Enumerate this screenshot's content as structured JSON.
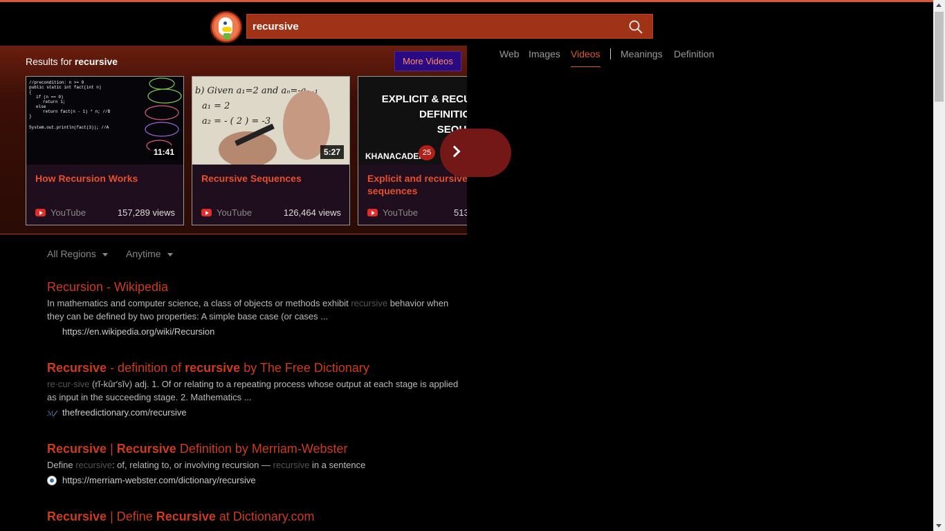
{
  "search": {
    "query": "recursive"
  },
  "tabs": {
    "web": "Web",
    "images": "Images",
    "videos": "Videos",
    "meanings": "Meanings",
    "definition": "Definition"
  },
  "videos": {
    "results_prefix": "Results for ",
    "results_term": "recursive",
    "more_label": "More Videos",
    "badge": "25",
    "cards": [
      {
        "duration": "11:41",
        "title": "How Recursion Works",
        "source": "YouTube",
        "views": "157,289 views"
      },
      {
        "duration": "5:27",
        "title": "Recursive Sequences",
        "source": "YouTube",
        "views": "126,464 views"
      },
      {
        "title": "Explicit and recursive definitions of sequences",
        "source": "YouTube",
        "views": "513",
        "thumb_text": "EXPLICIT & RECURSIVE DEFINITIONS OF SEQUENCES",
        "brand": "KHANACADEMY"
      }
    ]
  },
  "filters": {
    "region": "All Regions",
    "time": "Anytime"
  },
  "results": [
    {
      "title_parts": [
        "Recursion - Wikipedia"
      ],
      "snippet": [
        "In mathematics and computer science, a class of objects or methods exhibit ",
        "recursive",
        " behavior when they can be defined by two properties: A simple base case (or cases ..."
      ],
      "url": "https://en.wikipedia.org/wiki/Recursion"
    },
    {
      "title_parts": [
        "Recursive",
        " - definition of ",
        "recursive",
        " by The Free Dictionary"
      ],
      "snippet": [
        "re·cur·sive",
        " (rĭ-kûr′sĭv) adj. 1. Of or relating to a repeating process whose output at each stage is applied as input in the succeeding stage. 2. Mathematics ..."
      ],
      "url": "thefreedictionary.com/recursive"
    },
    {
      "title_parts": [
        "Recursive",
        " | ",
        "Recursive",
        " Definition by Merriam-Webster"
      ],
      "snippet": [
        "Define ",
        "recursive",
        ": of, relating to, or involving recursion — ",
        "recursive",
        " in a sentence"
      ],
      "url": "https://merriam-webster.com/dictionary/recursive"
    },
    {
      "title_parts": [
        "Recursive",
        " | Define ",
        "Recursive",
        " at Dictionary.com"
      ]
    }
  ]
}
